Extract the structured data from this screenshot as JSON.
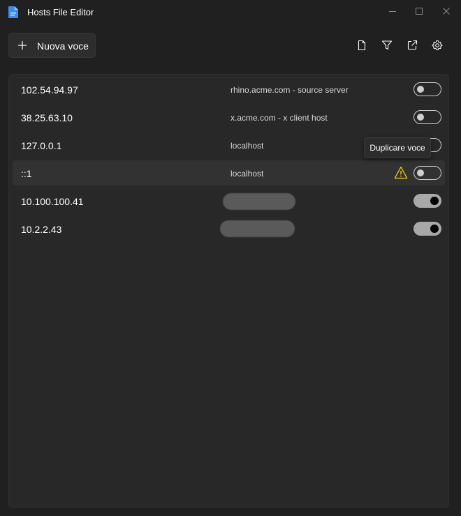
{
  "window": {
    "title": "Hosts File Editor",
    "icon": "hosts-file-app-icon",
    "controls": [
      "minimize-icon",
      "maximize-icon",
      "close-icon"
    ]
  },
  "toolbar": {
    "new_entry_label": "Nuova voce",
    "new_entry_icon": "plus-icon",
    "tools": [
      "file-icon",
      "filter-icon",
      "open-external-icon",
      "gear-icon"
    ]
  },
  "entries": [
    {
      "address": "102.54.94.97",
      "hosts": "rhino.acme.com - source server",
      "enabled": false,
      "hosts_redacted": false
    },
    {
      "address": "38.25.63.10",
      "hosts": "x.acme.com - x client host",
      "enabled": false,
      "hosts_redacted": false
    },
    {
      "address": "127.0.0.1",
      "hosts": "localhost",
      "enabled": false,
      "hosts_redacted": false
    },
    {
      "address": "::1",
      "hosts": "localhost",
      "enabled": false,
      "hosts_redacted": false,
      "warning": true
    },
    {
      "address": "10.100.100.41",
      "hosts": "",
      "enabled": true,
      "hosts_redacted": true
    },
    {
      "address": "10.2.2.43",
      "hosts": "",
      "enabled": true,
      "hosts_redacted": true
    }
  ],
  "tooltip": {
    "text": "Duplicare voce"
  },
  "colors": {
    "background": "#202020",
    "panel": "#282828",
    "accent_blue": "#3d8ee8",
    "warning": "#f2d20f"
  }
}
